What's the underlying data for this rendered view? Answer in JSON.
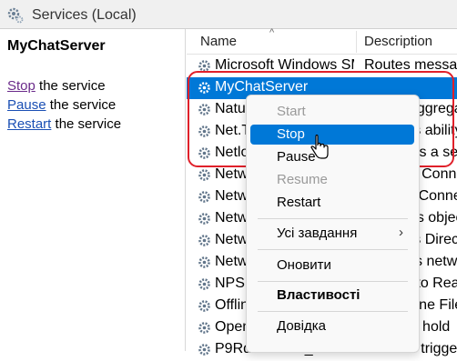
{
  "window": {
    "title": "Services (Local)"
  },
  "left_pane": {
    "service_name": "MyChatServer",
    "actions": [
      {
        "link": "Stop",
        "rest": " the service"
      },
      {
        "link": "Pause",
        "rest": " the service"
      },
      {
        "link": "Restart",
        "rest": " the service"
      }
    ]
  },
  "list": {
    "columns": {
      "name": "Name",
      "description": "Description"
    },
    "rows": [
      {
        "name": "Microsoft Windows SMS Router Service.",
        "desc": "Routes messages"
      },
      {
        "name": "MyChatServer",
        "desc": ""
      },
      {
        "name": "Natural Authentication",
        "desc": "Signal aggregator"
      },
      {
        "name": "Net.Tcp Port Sharing Service",
        "desc": "Provides ability"
      },
      {
        "name": "Netlogon",
        "desc": "Maintains a secure"
      },
      {
        "name": "Network Connected Devices Auto-Setup",
        "desc": "Network Connected"
      },
      {
        "name": "Network Connection Broker",
        "desc": "Brokers Connections"
      },
      {
        "name": "Network Connections",
        "desc": "Manages objects"
      },
      {
        "name": "Network Connectivity Assistant",
        "desc": "Provides DirectAccess"
      },
      {
        "name": "Network List Service",
        "desc": "Identifies networks"
      },
      {
        "name": "NPSMSvc_489d7",
        "desc": "<Failed to Read>"
      },
      {
        "name": "Offline Files",
        "desc": "The Offline Files"
      },
      {
        "name": "OpenSSH Authentication Agent",
        "desc": "Agent to hold"
      },
      {
        "name": "P9RdrService_489d7",
        "desc": "Enables trigger"
      }
    ]
  },
  "context_menu": {
    "items": [
      {
        "label": "Start",
        "state": "disabled"
      },
      {
        "label": "Stop",
        "state": "hover"
      },
      {
        "label": "Pause",
        "state": "normal"
      },
      {
        "label": "Resume",
        "state": "disabled"
      },
      {
        "label": "Restart",
        "state": "normal"
      },
      {
        "label": "Усі завдання",
        "state": "normal",
        "submenu": "›"
      },
      {
        "label": "Оновити",
        "state": "normal"
      },
      {
        "label": "Властивості",
        "state": "bold"
      },
      {
        "label": "Довідка",
        "state": "normal"
      }
    ]
  },
  "colors": {
    "selection": "#0078d7",
    "annotation": "#e0202a",
    "link": "#1a4fb4",
    "visited_link": "#6a2a8a"
  }
}
